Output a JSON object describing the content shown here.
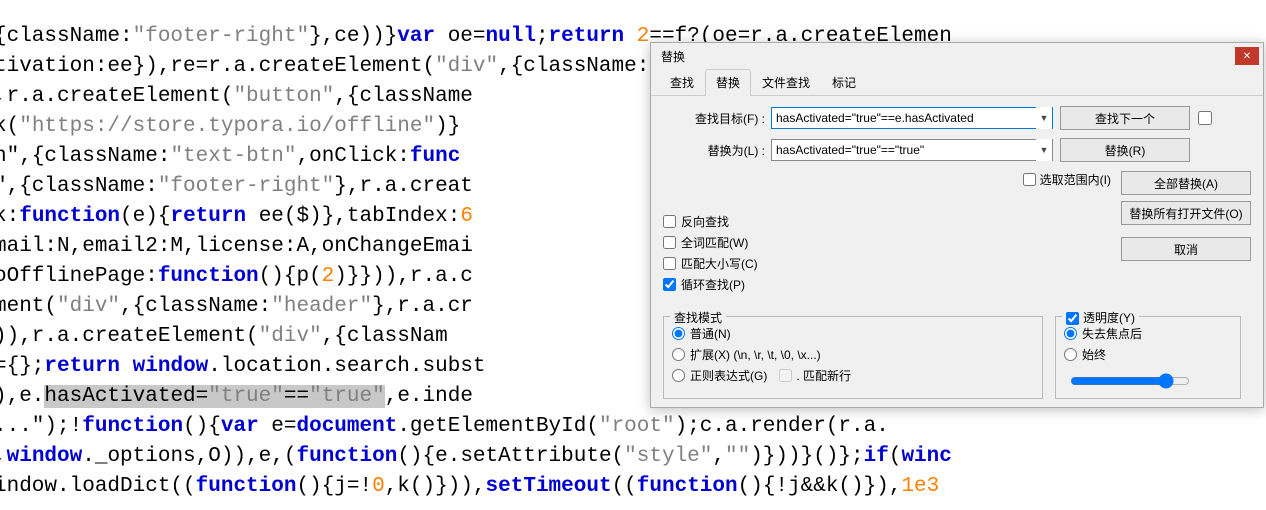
{
  "code": {
    "l1": "{className:\"footer-right\"},ce))}var oe=null;return 2==f?(oe=r.a.createElemen",
    "l2": "tivation:ee}),re=r.a.createElement(\"div\",{className:\"footer\"},r.a.createElem",
    "l3": ",r.a.createElement(\"button\",{className",
    "l4": "k(\"https://store.typora.io/offline\")}",
    "l5": "n\",{className:\"text-btn\",onClick:func",
    "l6": "\",{className:\"footer-right\"},r.a.creat",
    "l7": "k:function(e){return ee($)},tabIndex:6",
    "l8": "mail:N,email2:M,license:A,onChangeEmai",
    "l9": "oOfflinePage:function(){p(2)}})),r.a.c",
    "l10": "ment(\"div\",{className:\"header\"},r.a.cr",
    "l11": ")),r.a.createElement(\"div\",{classNam",
    "l12": "={};return window.location.search.subst",
    "l13a": "),e.",
    "l13b": "hasActivated=\"true\"==\"true\"",
    "l13c": ",e.inde",
    "l14": "...\");!function(){var e=document.getElementById(\"root\");c.a.render(r.a.",
    "l15": ",window._options,O)),e,(function(){e.setAttribute(\"style\",\"\")}))}()};if(winc",
    "l16": "indow.loadDict((function(){j=!0,k()})),setTimeout((function(){!j&&k()}),1e3"
  },
  "dialog": {
    "title": "替换",
    "tabs": {
      "search": "查找",
      "replace": "替换",
      "filesearch": "文件查找",
      "mark": "标记"
    },
    "labels": {
      "search_target": "查找目标(F) :",
      "replace_with": "替换为(L) :"
    },
    "inputs": {
      "search_value": "hasActivated=\"true\"==e.hasActivated",
      "replace_value": "hasActivated=\"true\"==\"true\""
    },
    "buttons": {
      "find_next": "查找下一个",
      "replace": "替换(R)",
      "replace_all": "全部替换(A)",
      "replace_all_open": "替换所有打开文件(O)",
      "cancel": "取消"
    },
    "checks": {
      "in_range": "选取范围内(I)",
      "reverse": "反向查找",
      "whole_word": "全词匹配(W)",
      "match_case": "匹配大小写(C)",
      "wrap": "循环查找(P)",
      "match_newline": ". 匹配新行"
    },
    "groups": {
      "search_mode": "查找模式",
      "radio_normal": "普通(N)",
      "radio_ext": "扩展(X) (\\n, \\r, \\t, \\0, \\x...)",
      "radio_regex": "正则表达式(G)",
      "opacity": "透明度(Y)",
      "radio_lose_focus": "失去焦点后",
      "radio_always": "始终"
    }
  }
}
